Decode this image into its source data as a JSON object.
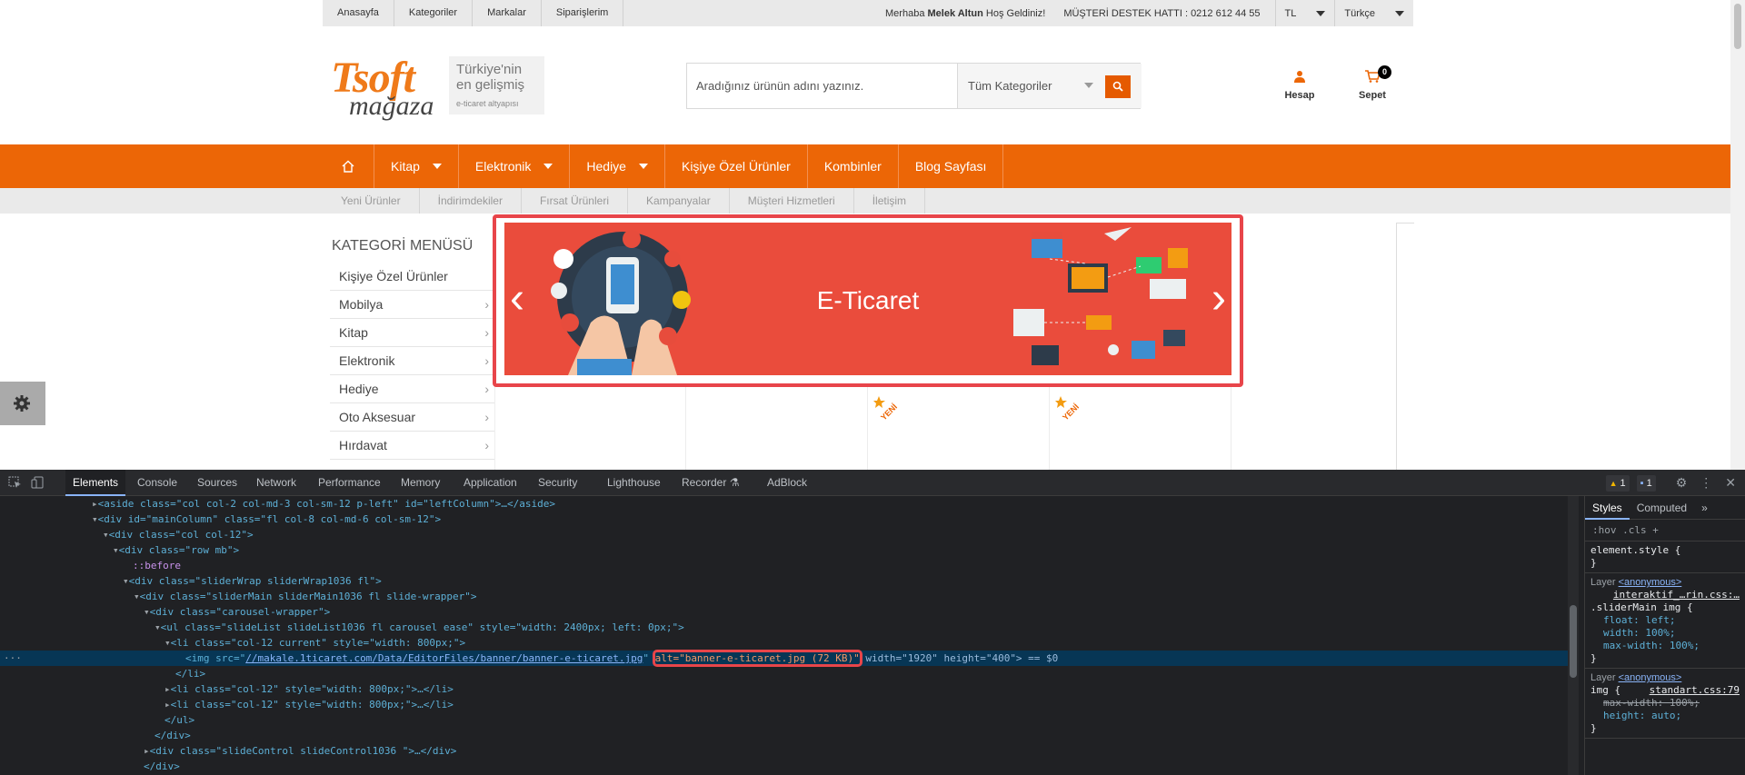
{
  "topbar": {
    "links": [
      "Anasayfa",
      "Kategoriler",
      "Markalar",
      "Siparişlerim"
    ],
    "greeting_prefix": "Merhaba",
    "user_name": "Melek Altun",
    "greeting_suffix": "Hoş Geldiniz!",
    "hotline": "MÜŞTERİ DESTEK HATTI : 0212 612 44 55",
    "currency": "TL",
    "language": "Türkçe"
  },
  "logo": {
    "brand": "Tsoft",
    "sub": "mağaza",
    "tagline_line1": "Türkiye'nin",
    "tagline_line2": "en gelişmiş",
    "tagline_small": "e-ticaret altyapısı"
  },
  "search": {
    "placeholder": "Aradığınız ürünün adını yazınız.",
    "category": "Tüm Kategoriler"
  },
  "account_label": "Hesap",
  "cart": {
    "label": "Sepet",
    "count": "0"
  },
  "main_nav": {
    "items": [
      {
        "label": "Kitap"
      },
      {
        "label": "Elektronik"
      },
      {
        "label": "Hediye"
      },
      {
        "label": "Kişiye Özel Ürünler"
      },
      {
        "label": "Kombinler"
      },
      {
        "label": "Blog Sayfası"
      }
    ]
  },
  "sub_nav": [
    "Yeni Ürünler",
    "İndirimdekiler",
    "Fırsat Ürünleri",
    "Kampanyalar",
    "Müşteri Hizmetleri",
    "İletişim"
  ],
  "category_menu": {
    "title": "KATEGORİ MENÜSÜ",
    "items": [
      "Kişiye Özel Ürünler",
      "Mobilya",
      "Kitap",
      "Elektronik",
      "Hediye",
      "Oto Aksesuar",
      "Hırdavat"
    ]
  },
  "banner": {
    "text": "E-Ticaret"
  },
  "product_badge": "YENİ",
  "colors": {
    "brand_orange": "#ec6606",
    "banner_red": "#ea4c3c",
    "highlight_red": "#e8454a"
  },
  "devtools": {
    "tabs": [
      "Elements",
      "Console",
      "Sources",
      "Network",
      "Performance",
      "Memory",
      "Application",
      "Security",
      "Lighthouse",
      "Recorder",
      "AdBlock"
    ],
    "warnings": "1",
    "messages": "1",
    "dom": {
      "l1": "<aside class=\"col col-2 col-md-3 col-sm-12 p-left\" id=\"leftColumn\">…</aside>",
      "l2": "<div id=\"mainColumn\" class=\"fl col-8 col-md-6 col-sm-12\">",
      "l3": "<div class=\"col col-12\">",
      "l4": "<div class=\"row mb\">",
      "l5": "::before",
      "l6": "<div class=\"sliderWrap sliderWrap1036 fl\">",
      "l7": "<div class=\"sliderMain sliderMain1036 fl slide-wrapper\">",
      "l8": "<div class=\"carousel-wrapper\">",
      "l9": "<ul class=\"slideList slideList1036 fl carousel ease\" style=\"width: 2400px; left: 0px;\">",
      "l10": "<li class=\"col-12 current\" style=\"width: 800px;\">",
      "img_src": "//makale.1ticaret.com/Data/EditorFiles/banner/banner-e-ticaret.jpg",
      "img_alt": "alt=\"banner-e-ticaret.jpg (72 KB)\"",
      "img_rest": " width=\"1920\" height=\"400\"> == $0",
      "l12": "</li>",
      "l13": "<li class=\"col-12\" style=\"width: 800px;\">…</li>",
      "l14": "<li class=\"col-12\" style=\"width: 800px;\">…</li>",
      "l15": "</ul>",
      "l16": "</div>",
      "l17": "<div class=\"slideControl slideControl1036 \">…</div>",
      "l18": "</div>"
    },
    "styles_panel": {
      "tabs": [
        "Styles",
        "Computed"
      ],
      "filter": ":hov  .cls  +",
      "element_style": "element.style {",
      "layer1": "Layer",
      "layer_name": "<anonymous>",
      "src1": "interaktif_…rin.css:…",
      "sel1": ".sliderMain img {",
      "p1": "float: left;",
      "p2": "width: 100%;",
      "p3": "max-width: 100%;",
      "sel2": "img {",
      "src2": "standart.css:79",
      "p4": "max-width: 100%;",
      "p5": "height: auto;"
    }
  }
}
